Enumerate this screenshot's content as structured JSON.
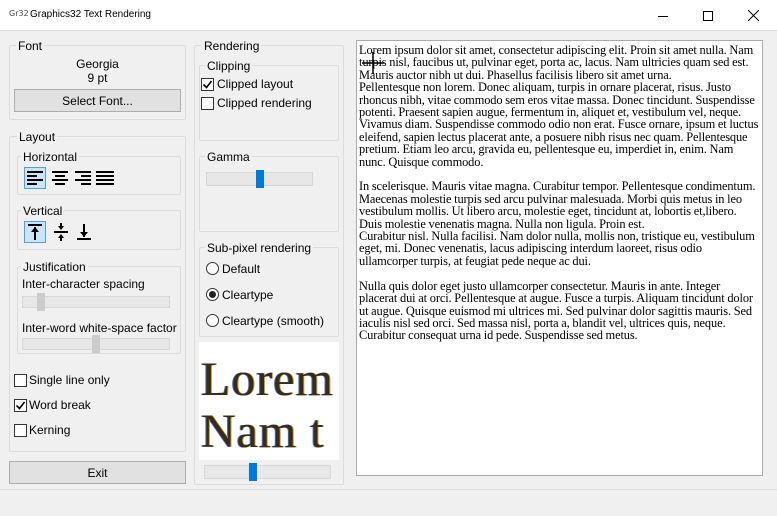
{
  "window": {
    "app_icon": "Gr32",
    "title": "Graphics32 Text Rendering"
  },
  "font": {
    "group_label": "Font",
    "name": "Georgia",
    "size": "9 pt",
    "select_button": "Select Font..."
  },
  "layout": {
    "group_label": "Layout",
    "horizontal_label": "Horizontal",
    "horizontal_options": [
      "align-left-icon",
      "align-center-icon",
      "align-right-icon",
      "align-justify-icon"
    ],
    "horizontal_selected": "align-left-icon",
    "vertical_label": "Vertical",
    "vertical_options": [
      "align-top-icon",
      "align-middle-icon",
      "align-bottom-icon"
    ],
    "vertical_selected": "align-top-icon",
    "justification_label": "Justification",
    "inter_char_label": "Inter-character spacing",
    "inter_char_value": 0.1,
    "inter_word_label": "Inter-word white-space factor",
    "inter_word_value": 0.5
  },
  "options": {
    "single_line": {
      "label": "Single line only",
      "checked": false
    },
    "word_break": {
      "label": "Word break",
      "checked": true
    },
    "kerning": {
      "label": "Kerning",
      "checked": false
    }
  },
  "exit_button": "Exit",
  "rendering": {
    "group_label": "Rendering",
    "clipping_label": "Clipping",
    "clipped_layout": {
      "label": "Clipped layout",
      "checked": true
    },
    "clipped_rendering": {
      "label": "Clipped rendering",
      "checked": false
    },
    "gamma_label": "Gamma",
    "gamma_value": 0.5,
    "subpixel_label": "Sub-pixel rendering",
    "subpixel_options": [
      "Default",
      "Cleartype",
      "Cleartype (smooth)"
    ],
    "subpixel_selected": "Cleartype",
    "preview_lines": [
      "Lorem",
      "Nam t"
    ],
    "preview_zoom": 0.38
  },
  "memo": {
    "paragraphs": [
      "Lorem ipsum dolor sit amet, consectetur adipiscing elit. Proin sit amet nulla. Nam turpis nisl, faucibus ut, pulvinar eget, porta ac, lacus. Nam ultricies quam sed est. Mauris auctor nibh ut dui. Phasellus facilisis libero sit amet urna.\nPellentesque non lorem. Donec aliquam, turpis in ornare placerat, risus. Justo rhoncus nibh, vitae commodo sem eros vitae massa. Donec tincidunt. Suspendisse potenti. Praesent sapien augue, fermentum in, aliquet et, vestibulum vel, neque. Vivamus diam. Suspendisse commodo odio non erat. Fusce ornare, ipsum et luctus eleifend, sapien lectus placerat ante, a posuere nibh risus nec quam. Pellentesque pretium. Etiam leo arcu, gravida eu, pellentesque eu, imperdiet in, enim. Nam nunc. Quisque commodo.",
      "In scelerisque. Mauris vitae magna. Curabitur tempor. Pellentesque condimentum. Maecenas molestie turpis sed arcu pulvinar malesuada. Morbi quis metus in leo vestibulum mollis. Ut libero arcu, molestie eget, tincidunt at, lobortis et,libero. Duis molestie venenatis magna. Nulla non ligula. Proin est.\nCurabitur nisl. Nulla facilisi. Nam dolor nulla, mollis non, tristique eu, vestibulum eget, mi. Donec venenatis, lacus adipiscing interdum laoreet, risus odio ullamcorper turpis, at feugiat pede neque ac dui.",
      "Nulla quis dolor eget justo ullamcorper consectetur. Mauris in ante. Integer placerat dui at orci. Pellentesque at augue. Fusce a turpis. Aliquam tincidunt dolor ut augue. Quisque euismod mi ultrices mi. Sed pulvinar dolor sagittis mauris. Sed iaculis nisl sed orci. Sed massa nisl, porta a, blandit vel, ultrices quis, neque. Curabitur consequat urna id pede. Suspendisse sed metus."
    ]
  }
}
